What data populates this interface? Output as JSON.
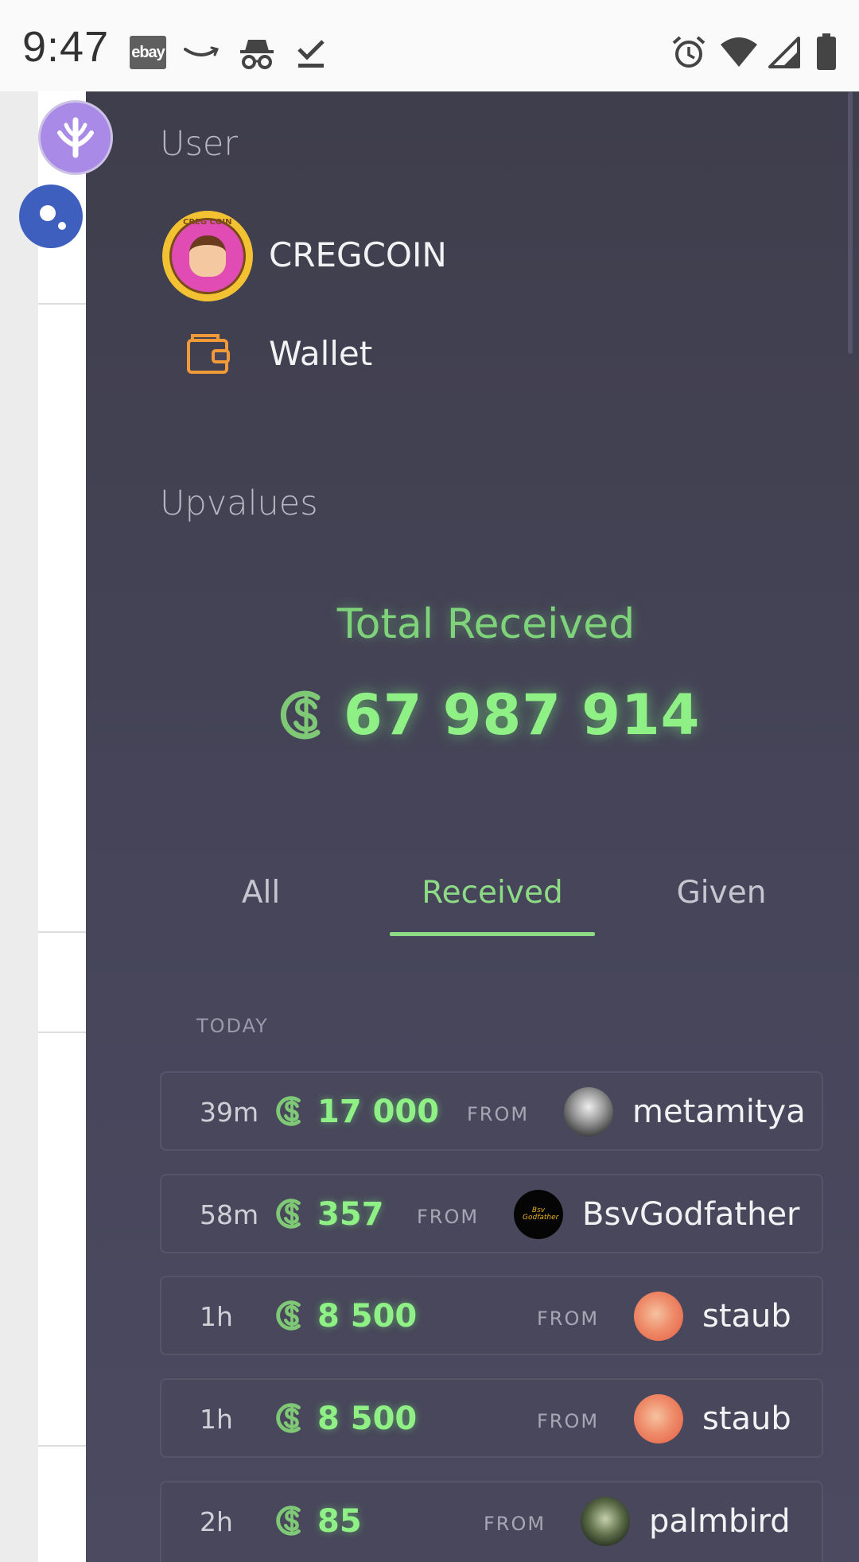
{
  "status_bar": {
    "time": "9:47",
    "ebay_label": "ebay"
  },
  "user_section": {
    "title": "User",
    "username": "CREGCOIN",
    "avatar_ring_text": "CREG COIN",
    "wallet_label": "Wallet"
  },
  "upvalues": {
    "title": "Upvalues",
    "total_label": "Total Received",
    "total_value": "67 987 914"
  },
  "tabs": [
    {
      "label": "All",
      "active": false
    },
    {
      "label": "Received",
      "active": true
    },
    {
      "label": "Given",
      "active": false
    }
  ],
  "day_label": "TODAY",
  "transactions": [
    {
      "time": "39m",
      "amount": "17 000",
      "from_label": "FROM",
      "name": "metamitya"
    },
    {
      "time": "58m",
      "amount": "357",
      "from_label": "FROM",
      "name": "BsvGodfather",
      "avatar_text": "Bsv Godfather"
    },
    {
      "time": "1h",
      "amount": "8 500",
      "from_label": "FROM",
      "name": "staub"
    },
    {
      "time": "1h",
      "amount": "8 500",
      "from_label": "FROM",
      "name": "staub"
    },
    {
      "time": "2h",
      "amount": "85",
      "from_label": "FROM",
      "name": "palmbird"
    }
  ],
  "colors": {
    "accent_green": "#8ef085",
    "drawer_bg": "#3f3e4c",
    "wallet_orange": "#f29a3a",
    "logo_purple": "#a98ae6"
  }
}
